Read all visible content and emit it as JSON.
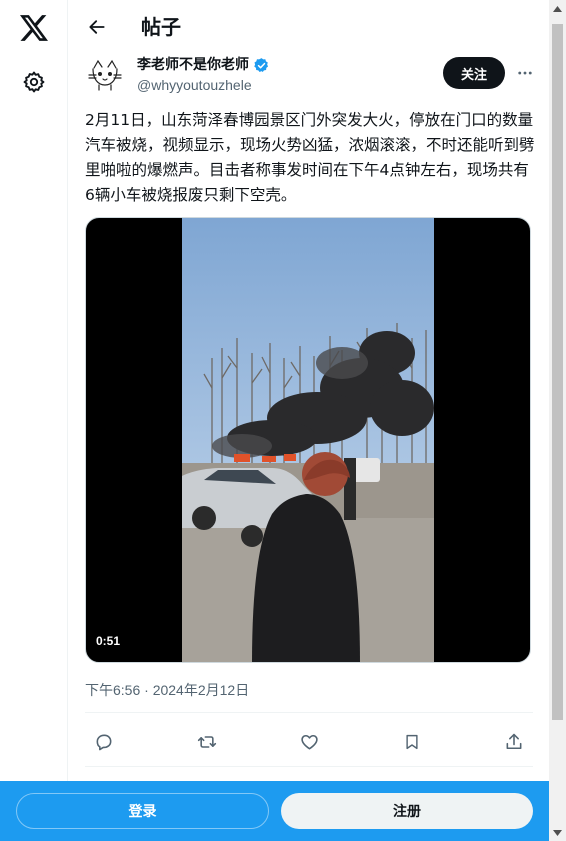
{
  "nav": {
    "logo_icon": "x-logo-icon",
    "settings_icon": "gear-icon"
  },
  "header": {
    "back_icon": "arrow-left-icon",
    "title": "帖子"
  },
  "author": {
    "name": "李老师不是你老师",
    "handle": "@whyyoutouzhele",
    "verified_icon": "verified-badge-icon",
    "verified_color": "#1d9bf0",
    "follow_label": "关注",
    "more_icon": "more-horizontal-icon"
  },
  "tweet": {
    "text": "2月11日，山东菏泽春博园景区门外突发大火，停放在门口的数量汽车被烧，视频显示，现场火势凶猛，浓烟滚滚，不时还能听到劈里啪啦的爆燃声。目击者称事发时间在下午4点钟左右，现场共有6辆小车被烧报废只剩下空壳。",
    "video_duration": "0:51",
    "timestamp": "下午6:56 · 2024年2月12日"
  },
  "actions": [
    {
      "name": "reply-icon"
    },
    {
      "name": "retweet-icon"
    },
    {
      "name": "like-icon"
    },
    {
      "name": "bookmark-icon"
    },
    {
      "name": "share-icon"
    }
  ],
  "bottom_bar": {
    "login_label": "登录",
    "signup_label": "注册",
    "background": "#1d9bf0"
  }
}
